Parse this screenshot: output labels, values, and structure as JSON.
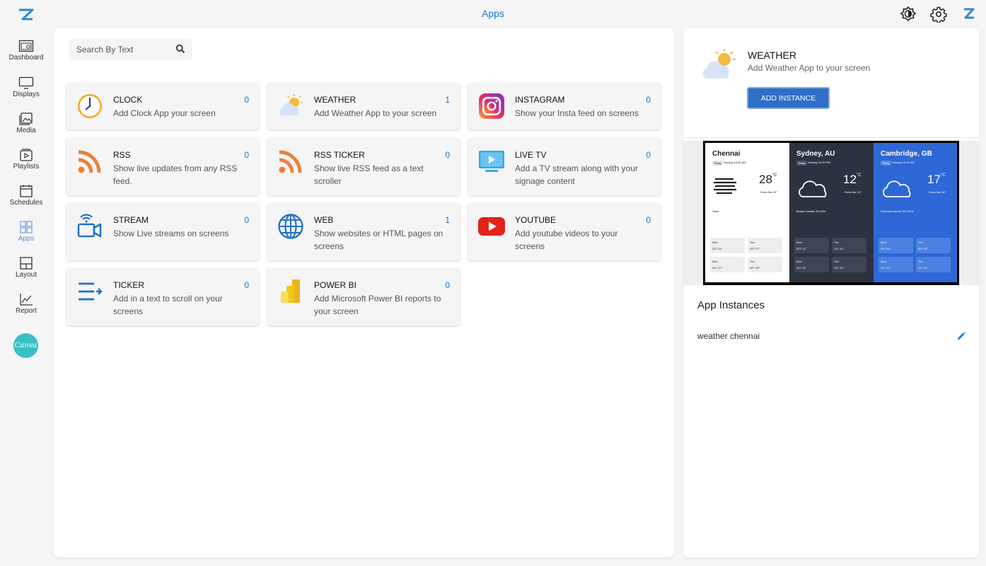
{
  "header": {
    "title": "Apps"
  },
  "sidebar": {
    "items": [
      {
        "label": "Dashboard",
        "icon": "dashboard-icon"
      },
      {
        "label": "Displays",
        "icon": "monitor-icon"
      },
      {
        "label": "Media",
        "icon": "image-icon"
      },
      {
        "label": "Playlists",
        "icon": "playlist-icon"
      },
      {
        "label": "Schedules",
        "icon": "calendar-icon"
      },
      {
        "label": "Apps",
        "icon": "apps-grid-icon",
        "active": true
      },
      {
        "label": "Layout",
        "icon": "layout-icon"
      },
      {
        "label": "Report",
        "icon": "chart-icon"
      }
    ],
    "canva_label": "Canva"
  },
  "search": {
    "placeholder": "Search By Text"
  },
  "apps": [
    {
      "title": "CLOCK",
      "desc": "Add Clock App your screen",
      "count": "0",
      "icon": "clock-icon"
    },
    {
      "title": "WEATHER",
      "desc": "Add Weather App to your screen",
      "count": "1",
      "icon": "weather-icon"
    },
    {
      "title": "INSTAGRAM",
      "desc": "Show your Insta feed on screens",
      "count": "0",
      "icon": "instagram-icon"
    },
    {
      "title": "RSS",
      "desc": "Show live updates from any RSS feed.",
      "count": "0",
      "icon": "rss-icon"
    },
    {
      "title": "RSS TICKER",
      "desc": "Show live RSS feed as a text scroller",
      "count": "0",
      "icon": "rss-ticker-icon"
    },
    {
      "title": "LIVE TV",
      "desc": "Add a TV stream along with your signage content",
      "count": "0",
      "icon": "live-tv-icon"
    },
    {
      "title": "STREAM",
      "desc": "Show Live streams on screens",
      "count": "0",
      "icon": "stream-icon"
    },
    {
      "title": "WEB",
      "desc": "Show websites or HTML pages on screens",
      "count": "1",
      "icon": "globe-icon"
    },
    {
      "title": "YOUTUBE",
      "desc": "Add youtube videos to your screens",
      "count": "0",
      "icon": "youtube-icon"
    },
    {
      "title": "TICKER",
      "desc": "Add in a text to scroll on your screens",
      "count": "0",
      "icon": "ticker-icon"
    },
    {
      "title": "POWER BI",
      "desc": "Add Microsoft Power BI reports to your screen",
      "count": "0",
      "icon": "power-bi-icon"
    }
  ],
  "detail": {
    "title": "WEATHER",
    "desc": "Add Weather App to your screen",
    "button": "ADD INSTANCE",
    "preview": [
      {
        "city": "Chennai",
        "chip": "Today",
        "time": "Sunday 10:50 AM",
        "temp": "28",
        "unit": "°C",
        "feels": "Feels like 34°",
        "cond": "Haze",
        "days": [
          {
            "d": "Mon",
            "t": "33°/ 26°"
          },
          {
            "d": "Tue",
            "t": "33°/ 27°"
          },
          {
            "d": "Mon",
            "t": "34°/ 27°"
          },
          {
            "d": "Tue",
            "t": "33°/ 28°"
          }
        ]
      },
      {
        "city": "Sydney, AU",
        "chip": "Today",
        "time": "Sunday 10:20 PM",
        "temp": "12",
        "unit": "°C",
        "feels": "Feels like 11°",
        "cond": "Broken clouds: 51-84%",
        "days": [
          {
            "d": "Mon",
            "t": "20°/ 11°"
          },
          {
            "d": "Tue",
            "t": "14°/ 11°"
          },
          {
            "d": "Mon",
            "t": "16°/ 11°"
          },
          {
            "d": "Tue",
            "t": "14°/ 11°"
          }
        ]
      },
      {
        "city": "Cambridge, GB",
        "chip": "Today",
        "time": "Sunday 10:54 AM",
        "temp": "17",
        "unit": "°C",
        "feels": "Feels like 16°",
        "cond": "Overcast clouds: 86-100%",
        "days": [
          {
            "d": "Mon",
            "t": "20°/ 12°"
          },
          {
            "d": "Tue",
            "t": "20°/ 11°"
          },
          {
            "d": "Mon",
            "t": "21°/ 11°"
          },
          {
            "d": "Tue",
            "t": "21°/ 11°"
          }
        ]
      }
    ],
    "instances_title": "App Instances",
    "instances": [
      {
        "name": "weather chennai"
      }
    ]
  },
  "colors": {
    "accent": "#1976d2",
    "button": "#2f6fc8",
    "canva": "#37c1c6"
  }
}
